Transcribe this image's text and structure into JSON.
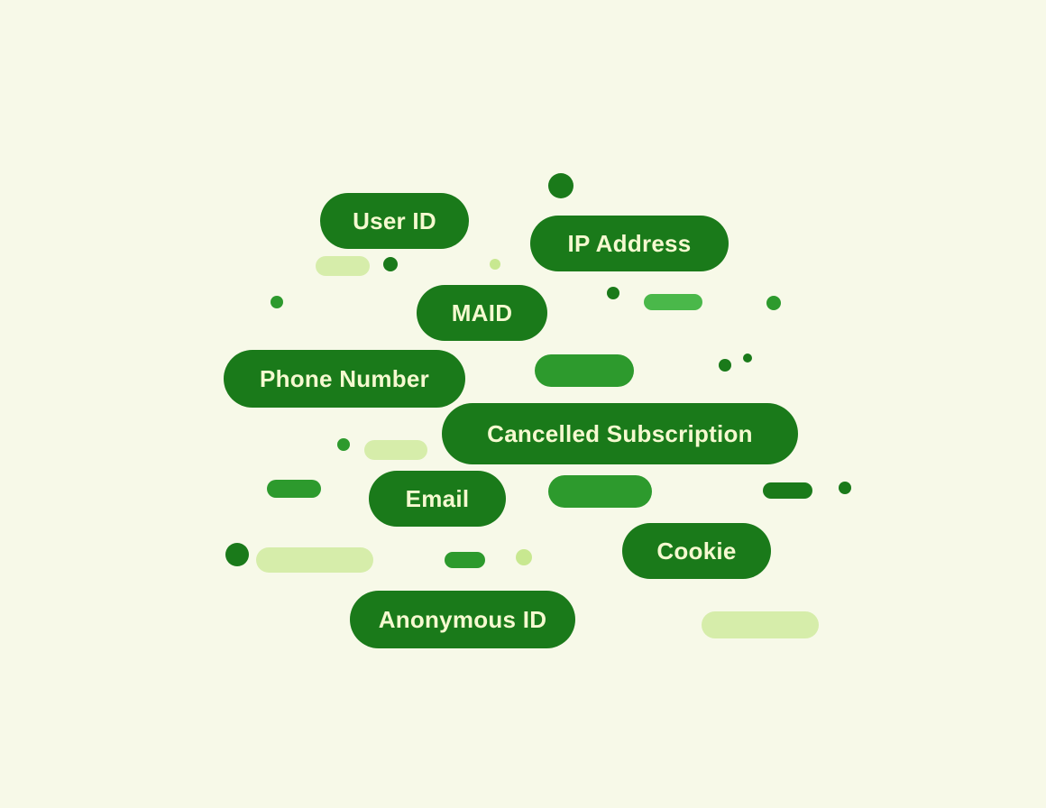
{
  "background": "#f7f9e8",
  "labels": {
    "user_id": "User ID",
    "ip_address": "IP Address",
    "maid": "MAID",
    "phone_number": "Phone Number",
    "cancelled_subscription": "Cancelled Subscription",
    "email": "Email",
    "cookie": "Cookie",
    "anonymous_id": "Anonymous ID"
  },
  "colors": {
    "dark_green": "#1a7a1a",
    "medium_green": "#2d9a2d",
    "light_pill": "#c8e890",
    "dot_dark": "#1a7a1a",
    "dot_medium": "#4ab84a",
    "dot_light": "#c8e890"
  }
}
